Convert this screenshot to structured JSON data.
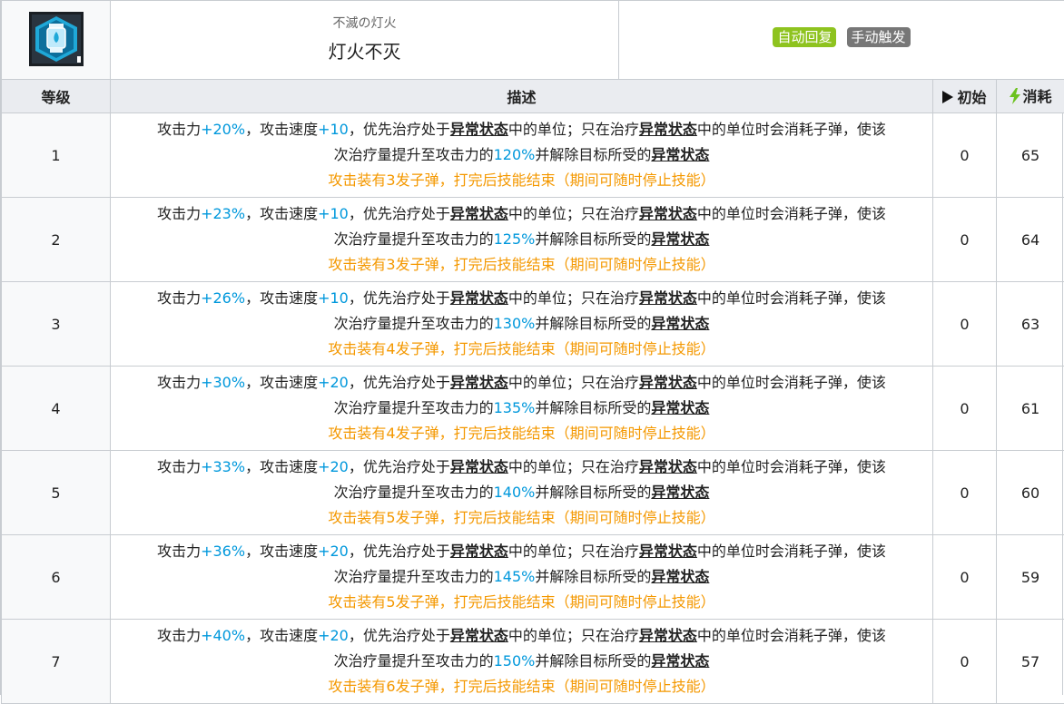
{
  "skill": {
    "sub_name": "不滅の灯火",
    "name": "灯火不灭",
    "tags": [
      {
        "label": "自动回复",
        "color": "#8ec31f"
      },
      {
        "label": "手动触发",
        "color": "#777777"
      }
    ],
    "icon": "lantern-icon"
  },
  "header": {
    "level": "等级",
    "description": "描述",
    "initial": "初始",
    "cost": "消耗",
    "initial_icon": "play-triangle-icon",
    "cost_icon": "lightning-bolt-icon"
  },
  "text": {
    "p1": "攻击力",
    "p2": "，攻击速度",
    "p3": "，优先治疗处于",
    "term": "异常状态",
    "p4": "中的单位；只在治疗",
    "p5": "中的单位时会消耗子弹，使该",
    "p6": "次治疗量提升至攻击力的",
    "p7": "并解除目标所受的",
    "a1": "攻击装有",
    "a2": "发子弹，打完后技能结束（期间可随时停止技能）"
  },
  "rows": [
    {
      "level": "1",
      "atk": "+20%",
      "aspd": "+10",
      "heal": "120%",
      "ammo": "3",
      "initial": "0",
      "cost": "65"
    },
    {
      "level": "2",
      "atk": "+23%",
      "aspd": "+10",
      "heal": "125%",
      "ammo": "3",
      "initial": "0",
      "cost": "64"
    },
    {
      "level": "3",
      "atk": "+26%",
      "aspd": "+10",
      "heal": "130%",
      "ammo": "4",
      "initial": "0",
      "cost": "63"
    },
    {
      "level": "4",
      "atk": "+30%",
      "aspd": "+20",
      "heal": "135%",
      "ammo": "4",
      "initial": "0",
      "cost": "61"
    },
    {
      "level": "5",
      "atk": "+33%",
      "aspd": "+20",
      "heal": "140%",
      "ammo": "5",
      "initial": "0",
      "cost": "60"
    },
    {
      "level": "6",
      "atk": "+36%",
      "aspd": "+20",
      "heal": "145%",
      "ammo": "5",
      "initial": "0",
      "cost": "59"
    },
    {
      "level": "7",
      "atk": "+40%",
      "aspd": "+20",
      "heal": "150%",
      "ammo": "6",
      "initial": "0",
      "cost": "57"
    }
  ]
}
